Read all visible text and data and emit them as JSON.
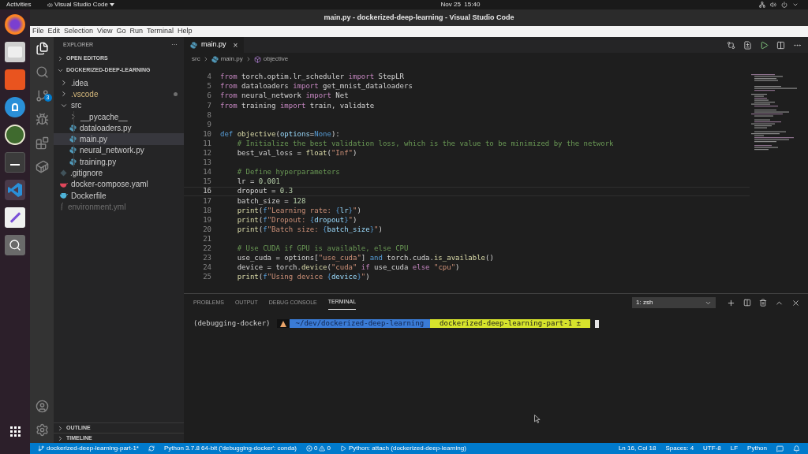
{
  "top_bar": {
    "activities": "Activities",
    "app_menu": "Visual Studio Code",
    "clock": "Nov 25  15:40"
  },
  "window": {
    "title": "main.py - dockerized-deep-learning - Visual Studio Code"
  },
  "menu": [
    "File",
    "Edit",
    "Selection",
    "View",
    "Go",
    "Run",
    "Terminal",
    "Help"
  ],
  "activity_bar": {
    "scm_badge": "3"
  },
  "sidebar": {
    "title": "EXPLORER",
    "more": "···",
    "open_editors": "OPEN EDITORS",
    "root": "DOCKERIZED-DEEP-LEARNING",
    "items": [
      {
        "name": ".idea",
        "kind": "folder",
        "expanded": false,
        "selected": false,
        "modified": false,
        "dimmed": false
      },
      {
        "name": ".vscode",
        "kind": "folder",
        "expanded": false,
        "selected": false,
        "modified": true,
        "dimmed": false
      },
      {
        "name": "src",
        "kind": "folder",
        "expanded": true,
        "selected": false,
        "modified": false,
        "dimmed": false,
        "children": [
          {
            "name": "__pycache__",
            "kind": "folder",
            "expanded": false,
            "selected": false,
            "modified": false,
            "dimmed": false
          },
          {
            "name": "dataloaders.py",
            "kind": "python",
            "selected": false,
            "modified": false,
            "dimmed": false
          },
          {
            "name": "main.py",
            "kind": "python",
            "selected": true,
            "modified": false,
            "dimmed": false
          },
          {
            "name": "neural_network.py",
            "kind": "python",
            "selected": false,
            "modified": false,
            "dimmed": false
          },
          {
            "name": "training.py",
            "kind": "python",
            "selected": false,
            "modified": false,
            "dimmed": false
          }
        ]
      },
      {
        "name": ".gitignore",
        "kind": "git",
        "selected": false,
        "modified": false,
        "dimmed": false
      },
      {
        "name": "docker-compose.yaml",
        "kind": "yaml",
        "selected": false,
        "modified": false,
        "dimmed": false
      },
      {
        "name": "Dockerfile",
        "kind": "docker",
        "selected": false,
        "modified": false,
        "dimmed": false
      },
      {
        "name": "environment.yml",
        "kind": "file",
        "selected": false,
        "modified": false,
        "dimmed": true
      }
    ],
    "outline": "OUTLINE",
    "timeline": "TIMELINE"
  },
  "editor": {
    "tab": "main.py",
    "tab_close": "×",
    "breadcrumb": [
      "src",
      "main.py",
      "objective"
    ],
    "lines": [
      {
        "number": "4",
        "current": false,
        "tokens": [
          {
            "kind": "kw",
            "text": "from"
          },
          {
            "kind": "p",
            "text": " torch.optim.lr_scheduler "
          },
          {
            "kind": "kw",
            "text": "import"
          },
          {
            "kind": "p",
            "text": " StepLR"
          }
        ]
      },
      {
        "number": "5",
        "current": false,
        "tokens": [
          {
            "kind": "kw",
            "text": "from"
          },
          {
            "kind": "p",
            "text": " dataloaders "
          },
          {
            "kind": "kw",
            "text": "import"
          },
          {
            "kind": "p",
            "text": " get_mnist_dataloaders"
          }
        ]
      },
      {
        "number": "6",
        "current": false,
        "tokens": [
          {
            "kind": "kw",
            "text": "from"
          },
          {
            "kind": "p",
            "text": " neural_network "
          },
          {
            "kind": "kw",
            "text": "import"
          },
          {
            "kind": "p",
            "text": " Net"
          }
        ]
      },
      {
        "number": "7",
        "current": false,
        "tokens": [
          {
            "kind": "kw",
            "text": "from"
          },
          {
            "kind": "p",
            "text": " training "
          },
          {
            "kind": "kw",
            "text": "import"
          },
          {
            "kind": "p",
            "text": " train, validate"
          }
        ]
      },
      {
        "number": "8",
        "current": false
      },
      {
        "number": "9",
        "current": false
      },
      {
        "number": "10",
        "current": false,
        "tokens": [
          {
            "kind": "key",
            "text": "def "
          },
          {
            "kind": "fn",
            "text": "objective"
          },
          {
            "kind": "p",
            "text": "("
          },
          {
            "kind": "var",
            "text": "options"
          },
          {
            "kind": "p",
            "text": "="
          },
          {
            "kind": "key",
            "text": "None"
          },
          {
            "kind": "p",
            "text": "):"
          }
        ]
      },
      {
        "number": "11",
        "current": false,
        "tokens": [
          {
            "kind": "c",
            "text": "    # Initialize the best validation loss, which is the value to be minimized by the network"
          }
        ]
      },
      {
        "number": "12",
        "current": false,
        "tokens": [
          {
            "kind": "p",
            "text": "    best_val_loss = "
          },
          {
            "kind": "fn",
            "text": "float"
          },
          {
            "kind": "p",
            "text": "("
          },
          {
            "kind": "s",
            "text": "\"Inf\""
          },
          {
            "kind": "p",
            "text": ")"
          }
        ]
      },
      {
        "number": "13",
        "current": false
      },
      {
        "number": "14",
        "current": false,
        "tokens": [
          {
            "kind": "c",
            "text": "    # Define hyperparameters"
          }
        ]
      },
      {
        "number": "15",
        "current": false,
        "tokens": [
          {
            "kind": "p",
            "text": "    lr = "
          },
          {
            "kind": "n",
            "text": "0.001"
          }
        ]
      },
      {
        "number": "16",
        "current": true,
        "tokens": [
          {
            "kind": "p",
            "text": "    dropout = "
          },
          {
            "kind": "n",
            "text": "0.3"
          }
        ]
      },
      {
        "number": "17",
        "current": false,
        "tokens": [
          {
            "kind": "p",
            "text": "    batch_size = "
          },
          {
            "kind": "n",
            "text": "128"
          }
        ]
      },
      {
        "number": "18",
        "current": false,
        "tokens": [
          {
            "kind": "fn",
            "text": "    print"
          },
          {
            "kind": "p",
            "text": "("
          },
          {
            "kind": "key",
            "text": "f"
          },
          {
            "kind": "s",
            "text": "\"Learning rate: "
          },
          {
            "kind": "key",
            "text": "{"
          },
          {
            "kind": "var",
            "text": "lr"
          },
          {
            "kind": "key",
            "text": "}"
          },
          {
            "kind": "s",
            "text": "\""
          },
          {
            "kind": "p",
            "text": ")"
          }
        ]
      },
      {
        "number": "19",
        "current": false,
        "tokens": [
          {
            "kind": "fn",
            "text": "    print"
          },
          {
            "kind": "p",
            "text": "("
          },
          {
            "kind": "key",
            "text": "f"
          },
          {
            "kind": "s",
            "text": "\"Dropout: "
          },
          {
            "kind": "key",
            "text": "{"
          },
          {
            "kind": "var",
            "text": "dropout"
          },
          {
            "kind": "key",
            "text": "}"
          },
          {
            "kind": "s",
            "text": "\""
          },
          {
            "kind": "p",
            "text": ")"
          }
        ]
      },
      {
        "number": "20",
        "current": false,
        "tokens": [
          {
            "kind": "fn",
            "text": "    print"
          },
          {
            "kind": "p",
            "text": "("
          },
          {
            "kind": "key",
            "text": "f"
          },
          {
            "kind": "s",
            "text": "\"Batch size: "
          },
          {
            "kind": "key",
            "text": "{"
          },
          {
            "kind": "var",
            "text": "batch_size"
          },
          {
            "kind": "key",
            "text": "}"
          },
          {
            "kind": "s",
            "text": "\""
          },
          {
            "kind": "p",
            "text": ")"
          }
        ]
      },
      {
        "number": "21",
        "current": false
      },
      {
        "number": "22",
        "current": false,
        "tokens": [
          {
            "kind": "c",
            "text": "    # Use CUDA if GPU is available, else CPU"
          }
        ]
      },
      {
        "number": "23",
        "current": false,
        "tokens": [
          {
            "kind": "p",
            "text": "    use_cuda = options["
          },
          {
            "kind": "s",
            "text": "\"use_cuda\""
          },
          {
            "kind": "p",
            "text": "] "
          },
          {
            "kind": "key",
            "text": "and"
          },
          {
            "kind": "p",
            "text": " torch.cuda."
          },
          {
            "kind": "fn",
            "text": "is_available"
          },
          {
            "kind": "p",
            "text": "()"
          }
        ]
      },
      {
        "number": "24",
        "current": false,
        "tokens": [
          {
            "kind": "p",
            "text": "    device = torch."
          },
          {
            "kind": "fn",
            "text": "device"
          },
          {
            "kind": "p",
            "text": "("
          },
          {
            "kind": "s",
            "text": "\"cuda\" "
          },
          {
            "kind": "kw",
            "text": "if"
          },
          {
            "kind": "p",
            "text": " use_cuda "
          },
          {
            "kind": "kw",
            "text": "else"
          },
          {
            "kind": "s",
            "text": " \"cpu\""
          },
          {
            "kind": "p",
            "text": ")"
          }
        ]
      },
      {
        "number": "25",
        "current": false,
        "tokens": [
          {
            "kind": "fn",
            "text": "    print"
          },
          {
            "kind": "p",
            "text": "("
          },
          {
            "kind": "key",
            "text": "f"
          },
          {
            "kind": "s",
            "text": "\"Using device "
          },
          {
            "kind": "key",
            "text": "{"
          },
          {
            "kind": "var",
            "text": "device"
          },
          {
            "kind": "key",
            "text": "}"
          },
          {
            "kind": "s",
            "text": "\""
          },
          {
            "kind": "p",
            "text": ")"
          }
        ]
      }
    ]
  },
  "panel": {
    "tabs": [
      {
        "label": "PROBLEMS",
        "selected": false
      },
      {
        "label": "OUTPUT",
        "selected": false
      },
      {
        "label": "DEBUG CONSOLE",
        "selected": false
      },
      {
        "label": "TERMINAL",
        "selected": true
      }
    ],
    "terminal_select": "1: zsh",
    "prompt": {
      "env": "(debugging-docker)",
      "path": "~/dev/dockerized-deep-learning",
      "branch": "dockerized-deep-learning-part-1 ±"
    }
  },
  "status_bar": {
    "branch": "dockerized-deep-learning-part-1*",
    "interpreter": "Python 3.7.8 64-bit ('debugging-docker': conda)",
    "errors": "0",
    "warnings": "0",
    "debug": "Python: attach (dockerized-deep-learning)",
    "position": "Ln 16, Col 18",
    "spaces": "Spaces: 4",
    "encoding": "UTF-8",
    "eol": "LF",
    "language": "Python"
  }
}
